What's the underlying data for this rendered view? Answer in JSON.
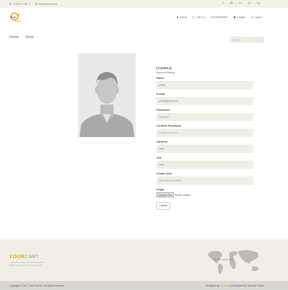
{
  "topbar": {
    "phone": "+2 0111 47 86 74",
    "email": "info@domain.com",
    "social_icons": [
      "facebook-icon",
      "twitter-icon",
      "linkedin-icon",
      "dribbble-icon",
      "google-plus-icon"
    ],
    "social_glyphs": [
      "f",
      "⁂",
      "in",
      "◎",
      "G+"
    ]
  },
  "header": {
    "logo_text_top": "YOUR",
    "logo_text_bottom": "CART",
    "user_label": "yuvraj",
    "cart_label": "Cart (1 )",
    "balance_label": "$ 8.999999987",
    "charge_label": "Charge",
    "logout_label": "Logout"
  },
  "nav": {
    "items": [
      "Home",
      "Shop"
    ],
    "search_placeholder": "Search"
  },
  "profile": {
    "username": "[YUVRAJ]",
    "subtitle": "Account Setting",
    "name_label": "Name",
    "name_value": "yuvraj",
    "email_label": "E-mail",
    "email_value": "yuvraj@gmail.com",
    "password_label": "Password",
    "password_placeholder": "Password",
    "confirm_label": "Confirm Password",
    "confirm_placeholder": "Confirm Password",
    "address_label": "Address",
    "address_value": "tirrrai",
    "job_label": "Job",
    "job_value": "tirrrai",
    "card_label": "Credit Card",
    "card_placeholder": "#### #### #### ####",
    "image_label": "Image",
    "choose_file_label": "Choose File",
    "no_file_label": "No file chosen",
    "update_label": "Update"
  },
  "footer": {
    "brand_part1": "YOUR",
    "brand_part2": "CART",
    "blurb": "Lorem ipsum dolor sit amet, consectetur adipisicing elit, sed do eiusmod tempor",
    "address": "435 Tahrir street, Cairo",
    "copyright": "Copyright © 2017 YourCart Inc. All rights reserved.",
    "designed_prefix": "Designed by ",
    "designed_link": "Yourcart",
    "designed_suffix": " | Developed By YourCart Team"
  },
  "colors": {
    "accent": "#e9a400",
    "topbar_bg": "#f3f1ea",
    "footer_bg": "#f0eee7",
    "bottombar_bg": "#d8d7d1",
    "field_bg": "#efeee8"
  }
}
